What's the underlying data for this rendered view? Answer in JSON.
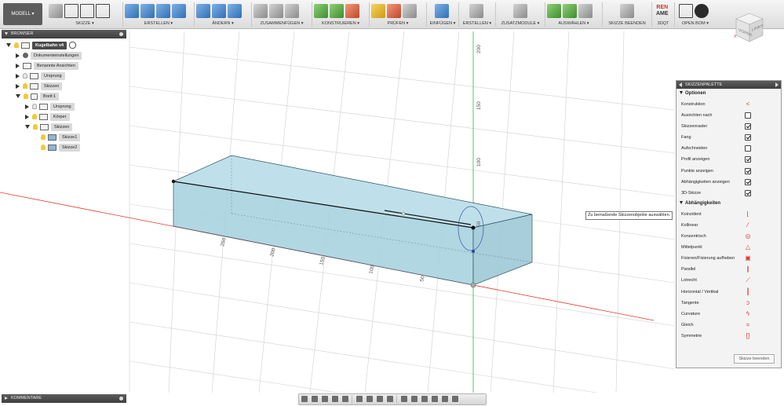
{
  "toolbar": {
    "workspace": "MODELL ▾",
    "groups": [
      {
        "label": "SKIZZE ▾"
      },
      {
        "label": "ERSTELLEN ▾"
      },
      {
        "label": "ÄNDERN ▾"
      },
      {
        "label": "ZUSAMMENFÜGEN ▾"
      },
      {
        "label": "KONSTRUIEREN ▾"
      },
      {
        "label": "PRÜFEN ▾"
      },
      {
        "label": "EINFÜGEN ▾"
      },
      {
        "label": "ERSTELLEN ▾"
      },
      {
        "label": "ZUSATZMODULE ▾"
      },
      {
        "label": "AUSWÄHLEN ▾"
      },
      {
        "label": "SKIZZE BEENDEN"
      },
      {
        "label": "3DQT",
        "icon_text_top": "REN",
        "icon_text_bottom": "AME"
      },
      {
        "label": "OPEN BOM ▾"
      }
    ]
  },
  "viewcube": {
    "front": "VORNE",
    "right": "LINKS"
  },
  "browser": {
    "title": "BROWSER",
    "items": [
      {
        "label": "Kugelbahn v4"
      },
      {
        "label": "Dokumenteinstellungen"
      },
      {
        "label": "Benannte Ansichten"
      },
      {
        "label": "Ursprung"
      },
      {
        "label": "Skizzen"
      },
      {
        "label": "Brett:1"
      },
      {
        "label": "Ursprung"
      },
      {
        "label": "Körper"
      },
      {
        "label": "Skizzen"
      },
      {
        "label": "Skizze1"
      },
      {
        "label": "Skizze2"
      }
    ]
  },
  "comment": {
    "title": "KOMMENTARE"
  },
  "tooltip": "Zu bemaßende Skizzenobjekte auswählen.",
  "palette": {
    "title": "SKIZZENPALETTE",
    "options_title": "Optionen",
    "options": [
      {
        "label": "Konstruktion",
        "icon": "construction-icon"
      },
      {
        "label": "Ausrichten nach",
        "icon": "look-at-icon"
      },
      {
        "label": "Skizzenraster",
        "checked": true
      },
      {
        "label": "Fang",
        "checked": true
      },
      {
        "label": "Aufschneiden",
        "checked": false
      },
      {
        "label": "Profil anzeigen",
        "checked": true
      },
      {
        "label": "Punkte anzeigen",
        "checked": true
      },
      {
        "label": "Abhängigkeiten anzeigen",
        "checked": true
      },
      {
        "label": "3D-Skizze",
        "checked": true
      }
    ],
    "constraints_title": "Abhängigkeiten",
    "constraints": [
      {
        "label": "Koinzident",
        "icon": "coincident-icon"
      },
      {
        "label": "Kollinear",
        "icon": "collinear-icon"
      },
      {
        "label": "Konzentrisch",
        "icon": "concentric-icon"
      },
      {
        "label": "Mittelpunkt",
        "icon": "midpoint-icon"
      },
      {
        "label": "Fixieren/Fixierung aufheben",
        "icon": "lock-icon"
      },
      {
        "label": "Parallel",
        "icon": "parallel-icon"
      },
      {
        "label": "Lotrecht",
        "icon": "perpendicular-icon"
      },
      {
        "label": "Horizontal / Vertikal",
        "icon": "horizontal-vertical-icon"
      },
      {
        "label": "Tangente",
        "icon": "tangent-icon"
      },
      {
        "label": "Curvature",
        "icon": "curvature-icon"
      },
      {
        "label": "Gleich",
        "icon": "equal-icon"
      },
      {
        "label": "Symmetrie",
        "icon": "symmetry-icon"
      }
    ],
    "finish_label": "Skizze beenden"
  },
  "axis_labels": {
    "vertical": [
      "200",
      "150",
      "100",
      "50"
    ],
    "horizontal": [
      "250",
      "200",
      "150",
      "100",
      "50"
    ]
  },
  "colors": {
    "body_fill": "#a9d3e0",
    "grid": "#c9c9c9",
    "x_axis": "#e0392b",
    "y_axis": "#45c245"
  }
}
